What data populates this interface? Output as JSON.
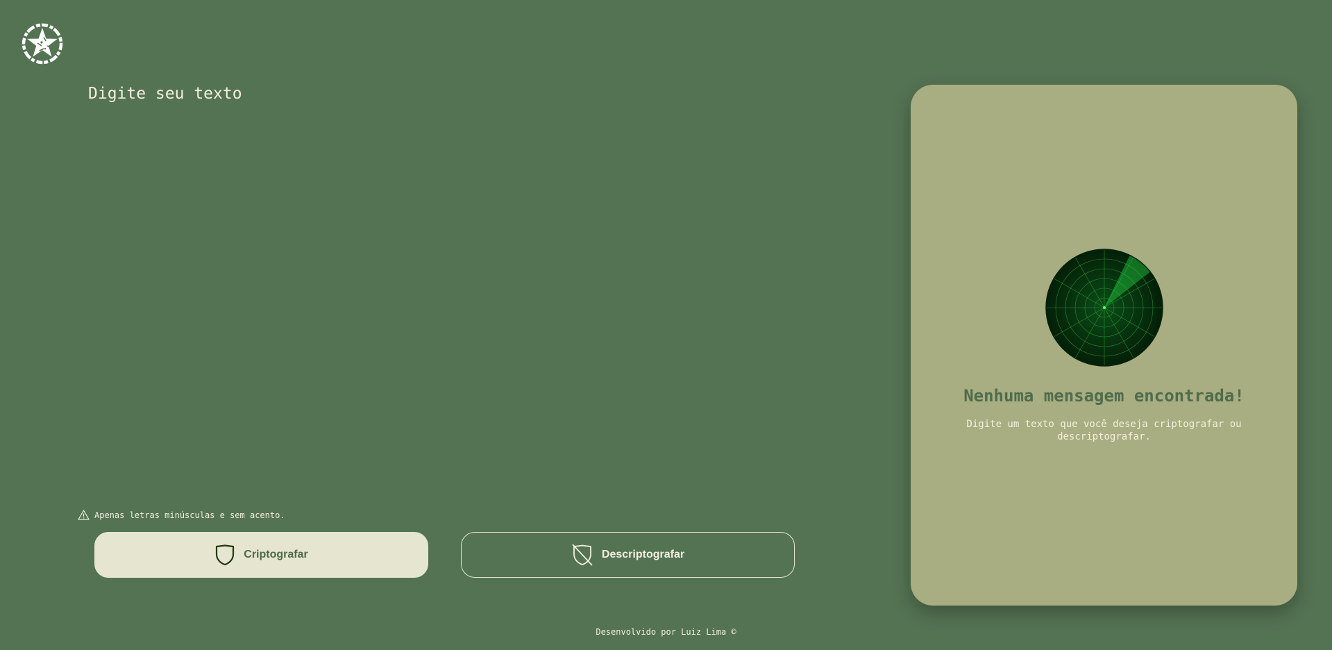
{
  "logo": {
    "icon": "star-emblem-icon"
  },
  "input": {
    "placeholder": "Digite seu texto",
    "value": ""
  },
  "warning": {
    "icon": "warning-triangle-icon",
    "text": "Apenas letras minúsculas e sem acento."
  },
  "buttons": {
    "encrypt": {
      "label": "Criptografar",
      "icon": "shield-icon"
    },
    "decrypt": {
      "label": "Descriptografar",
      "icon": "shield-off-icon"
    }
  },
  "output_panel": {
    "illustration": "radar-icon",
    "title": "Nenhuma mensagem encontrada!",
    "text": "Digite um texto que você deseja criptografar ou descriptografar."
  },
  "footer": {
    "text": "Desenvolvido por Luiz Lima ©"
  },
  "colors": {
    "background": "#547353",
    "panel": "#a8ae82",
    "button_light": "#e6e5cf",
    "text_light": "#f2f0dc",
    "panel_title": "#4f6c4c",
    "radar_green": "#1fbf3a"
  }
}
